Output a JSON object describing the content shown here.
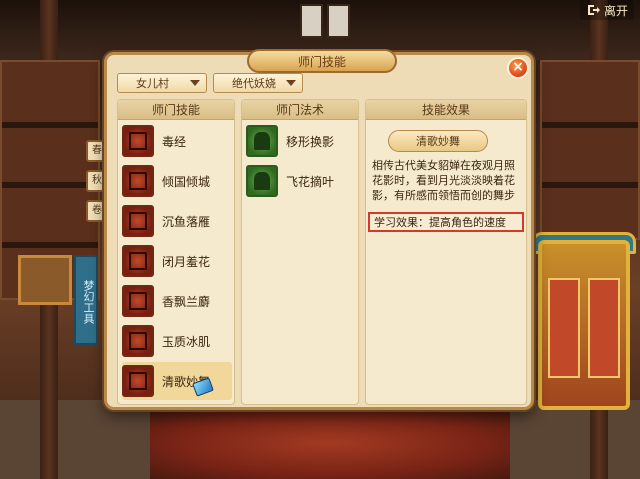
{
  "top_bar": {
    "leave_label": "离开",
    "leave_icon": "exit-arrow-icon"
  },
  "scene": {
    "banner_text": "梦幻工具",
    "side_tabs": [
      "春",
      "秋",
      "卷"
    ]
  },
  "dialog": {
    "title": "师门技能",
    "close_label": "×",
    "dropdowns": [
      {
        "selected": "女儿村"
      },
      {
        "selected": "绝代妖娆"
      }
    ],
    "columns": {
      "skills_header": "师门技能",
      "spells_header": "师门法术",
      "effect_header": "技能效果"
    },
    "skills": [
      {
        "name": "毒经",
        "icon": "poison-scroll-icon"
      },
      {
        "name": "倾国倾城",
        "icon": "beauty-icon"
      },
      {
        "name": "沉鱼落雁",
        "icon": "fish-goose-icon"
      },
      {
        "name": "闭月羞花",
        "icon": "moon-flower-icon"
      },
      {
        "name": "香飘兰麝",
        "icon": "fragrance-icon"
      },
      {
        "name": "玉质冰肌",
        "icon": "jade-skin-icon"
      },
      {
        "name": "清歌妙舞",
        "icon": "dance-icon",
        "selected": true
      }
    ],
    "spells": [
      {
        "name": "移形换影",
        "icon": "shadow-move-icon"
      },
      {
        "name": "飞花摘叶",
        "icon": "flying-flower-icon"
      }
    ],
    "effect": {
      "skill_button": "清歌妙舞",
      "description": "相传古代美女貂婵在夜观月照花影时，看到月光淡淡映着花影，有所感而领悟而创的舞步",
      "learn_effect": "学习效果：提高角色的速度"
    }
  },
  "colors": {
    "dialog_bg": "#eddcb6",
    "highlight_border": "#d23a2a",
    "close_button": "#d8461a"
  }
}
